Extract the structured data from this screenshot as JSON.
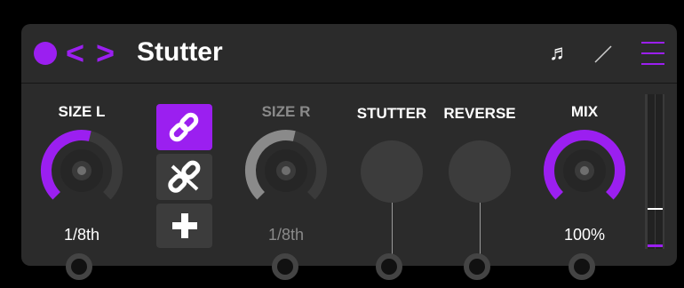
{
  "header": {
    "title": "Stutter",
    "prev_icon": "chevron-left-icon",
    "next_icon": "chevron-right-icon",
    "power_icon": "power-dot-icon",
    "sync_icon": "music-note-icon",
    "edit_icon": "slash-icon",
    "menu_icon": "hamburger-menu-icon"
  },
  "controls": {
    "size_l": {
      "label": "SIZE L",
      "value": "1/8th",
      "level": 0.55,
      "active": true
    },
    "size_r": {
      "label": "SIZE R",
      "value": "1/8th",
      "level": 0.55,
      "active": false
    },
    "stutter": {
      "label": "STUTTER"
    },
    "reverse": {
      "label": "REVERSE"
    },
    "mix": {
      "label": "MIX",
      "value": "100%",
      "level": 1.0,
      "active": true
    }
  },
  "link_buttons": [
    {
      "name": "link-icon",
      "active": true
    },
    {
      "name": "unlink-icon",
      "active": false
    },
    {
      "name": "plus-icon",
      "active": false
    }
  ],
  "meter": {
    "level": 0.23
  },
  "colors": {
    "accent": "#9b1ff0",
    "panel": "#2b2b2b",
    "track": "#3a3a3a"
  }
}
